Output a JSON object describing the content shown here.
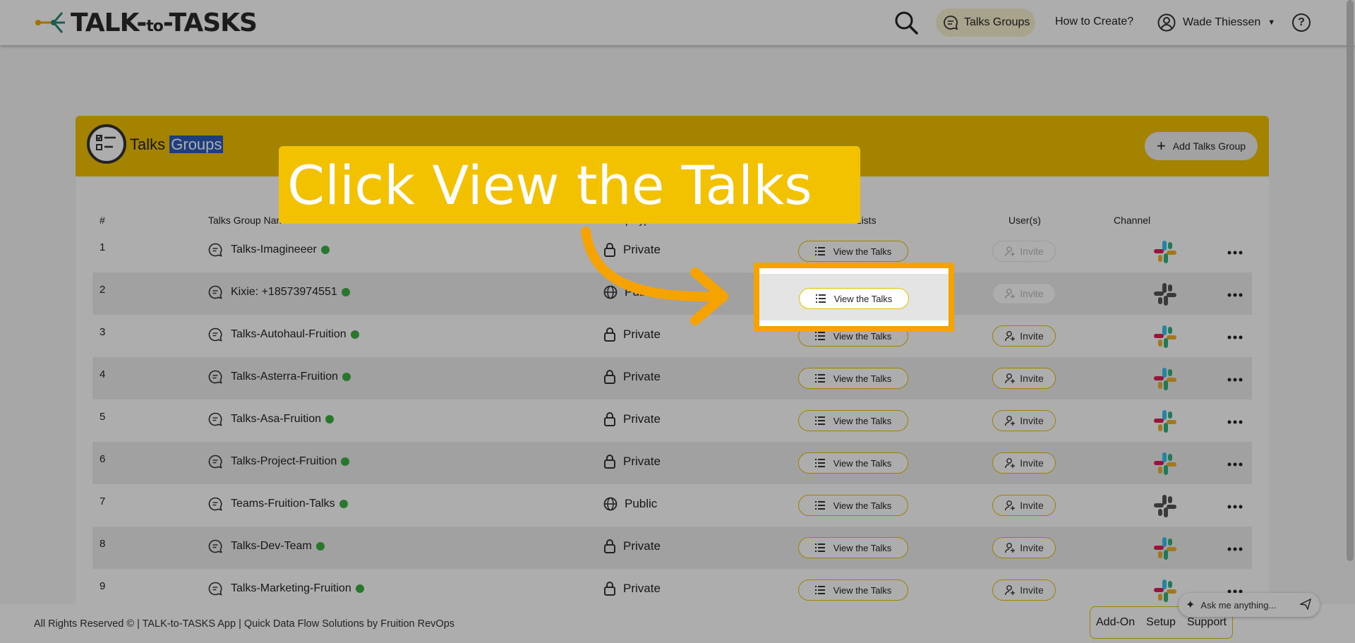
{
  "app": {
    "logo_text_pre": "TALK-",
    "logo_text_mid": "to",
    "logo_text_post": "-TASKS"
  },
  "nav": {
    "talks_groups": "Talks Groups",
    "how_to_create": "How to Create?",
    "user_name": "Wade Thiessen",
    "help": "?"
  },
  "card": {
    "title_plain": "Talks",
    "title_selected": "Groups",
    "add_button": "Add Talks Group"
  },
  "table": {
    "headers": {
      "num": "#",
      "name": "Talks Group Name",
      "type": "Group Type",
      "lists": "Talks Lists",
      "users": "User(s)",
      "channel": "Channel"
    },
    "view_label": "View the Talks",
    "invite_label": "Invite",
    "rows": [
      {
        "num": "1",
        "name": "Talks-Imagineeer",
        "type": "Private"
      },
      {
        "num": "2",
        "name": "Kixie: +18573974551",
        "type": "Public"
      },
      {
        "num": "3",
        "name": "Talks-Autohaul-Fruition",
        "type": "Private"
      },
      {
        "num": "4",
        "name": "Talks-Asterra-Fruition",
        "type": "Private"
      },
      {
        "num": "5",
        "name": "Talks-Asa-Fruition",
        "type": "Private"
      },
      {
        "num": "6",
        "name": "Talks-Project-Fruition",
        "type": "Private"
      },
      {
        "num": "7",
        "name": "Teams-Fruition-Talks",
        "type": "Public"
      },
      {
        "num": "8",
        "name": "Talks-Dev-Team",
        "type": "Private"
      },
      {
        "num": "9",
        "name": "Talks-Marketing-Fruition",
        "type": "Private"
      }
    ]
  },
  "callout": {
    "text": "Click View the Talks"
  },
  "footer": {
    "text": "All Rights Reserved © | TALK-to-TASKS App | Quick Data Flow Solutions by Fruition RevOps",
    "addon": "Add-On",
    "setup": "Setup",
    "support": "Support"
  },
  "assistant": {
    "placeholder": "Ask me anything..."
  },
  "colors": {
    "brand_yellow": "#f2c200",
    "highlight_orange": "#f5a300",
    "online_green": "#3cb043"
  }
}
